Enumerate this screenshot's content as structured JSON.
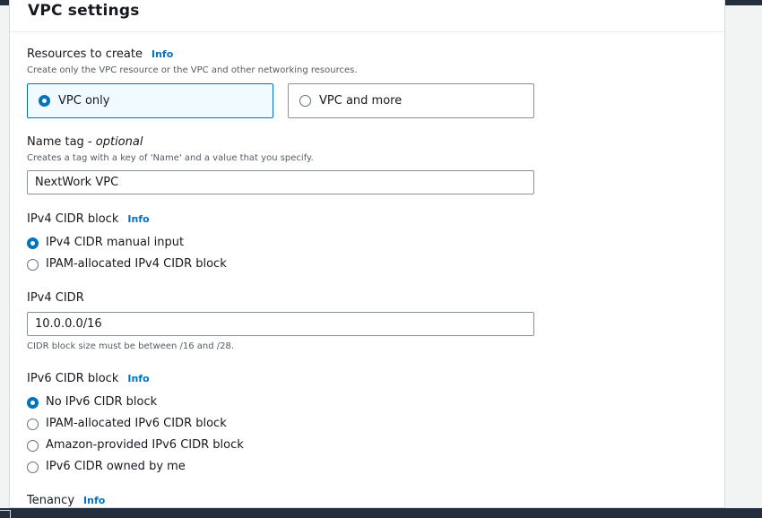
{
  "panel": {
    "title": "VPC settings"
  },
  "resources": {
    "label": "Resources to create",
    "info": "Info",
    "description": "Create only the VPC resource or the VPC and other networking resources.",
    "options": [
      {
        "label": "VPC only",
        "selected": true
      },
      {
        "label": "VPC and more",
        "selected": false
      }
    ]
  },
  "name_tag": {
    "label": "Name tag - ",
    "optional": "optional",
    "description": "Creates a tag with a key of 'Name' and a value that you specify.",
    "value": "NextWork VPC"
  },
  "ipv4_block": {
    "label": "IPv4 CIDR block",
    "info": "Info",
    "options": [
      {
        "label": "IPv4 CIDR manual input",
        "selected": true
      },
      {
        "label": "IPAM-allocated IPv4 CIDR block",
        "selected": false
      }
    ]
  },
  "ipv4_cidr": {
    "label": "IPv4 CIDR",
    "value": "10.0.0.0/16",
    "hint": "CIDR block size must be between /16 and /28."
  },
  "ipv6_block": {
    "label": "IPv6 CIDR block",
    "info": "Info",
    "options": [
      {
        "label": "No IPv6 CIDR block",
        "selected": true
      },
      {
        "label": "IPAM-allocated IPv6 CIDR block",
        "selected": false
      },
      {
        "label": "Amazon-provided IPv6 CIDR block",
        "selected": false
      },
      {
        "label": "IPv6 CIDR owned by me",
        "selected": false
      }
    ]
  },
  "tenancy": {
    "label": "Tenancy",
    "info": "Info"
  },
  "colors": {
    "accent": "#0073bb",
    "header_bar": "#232f3e"
  }
}
